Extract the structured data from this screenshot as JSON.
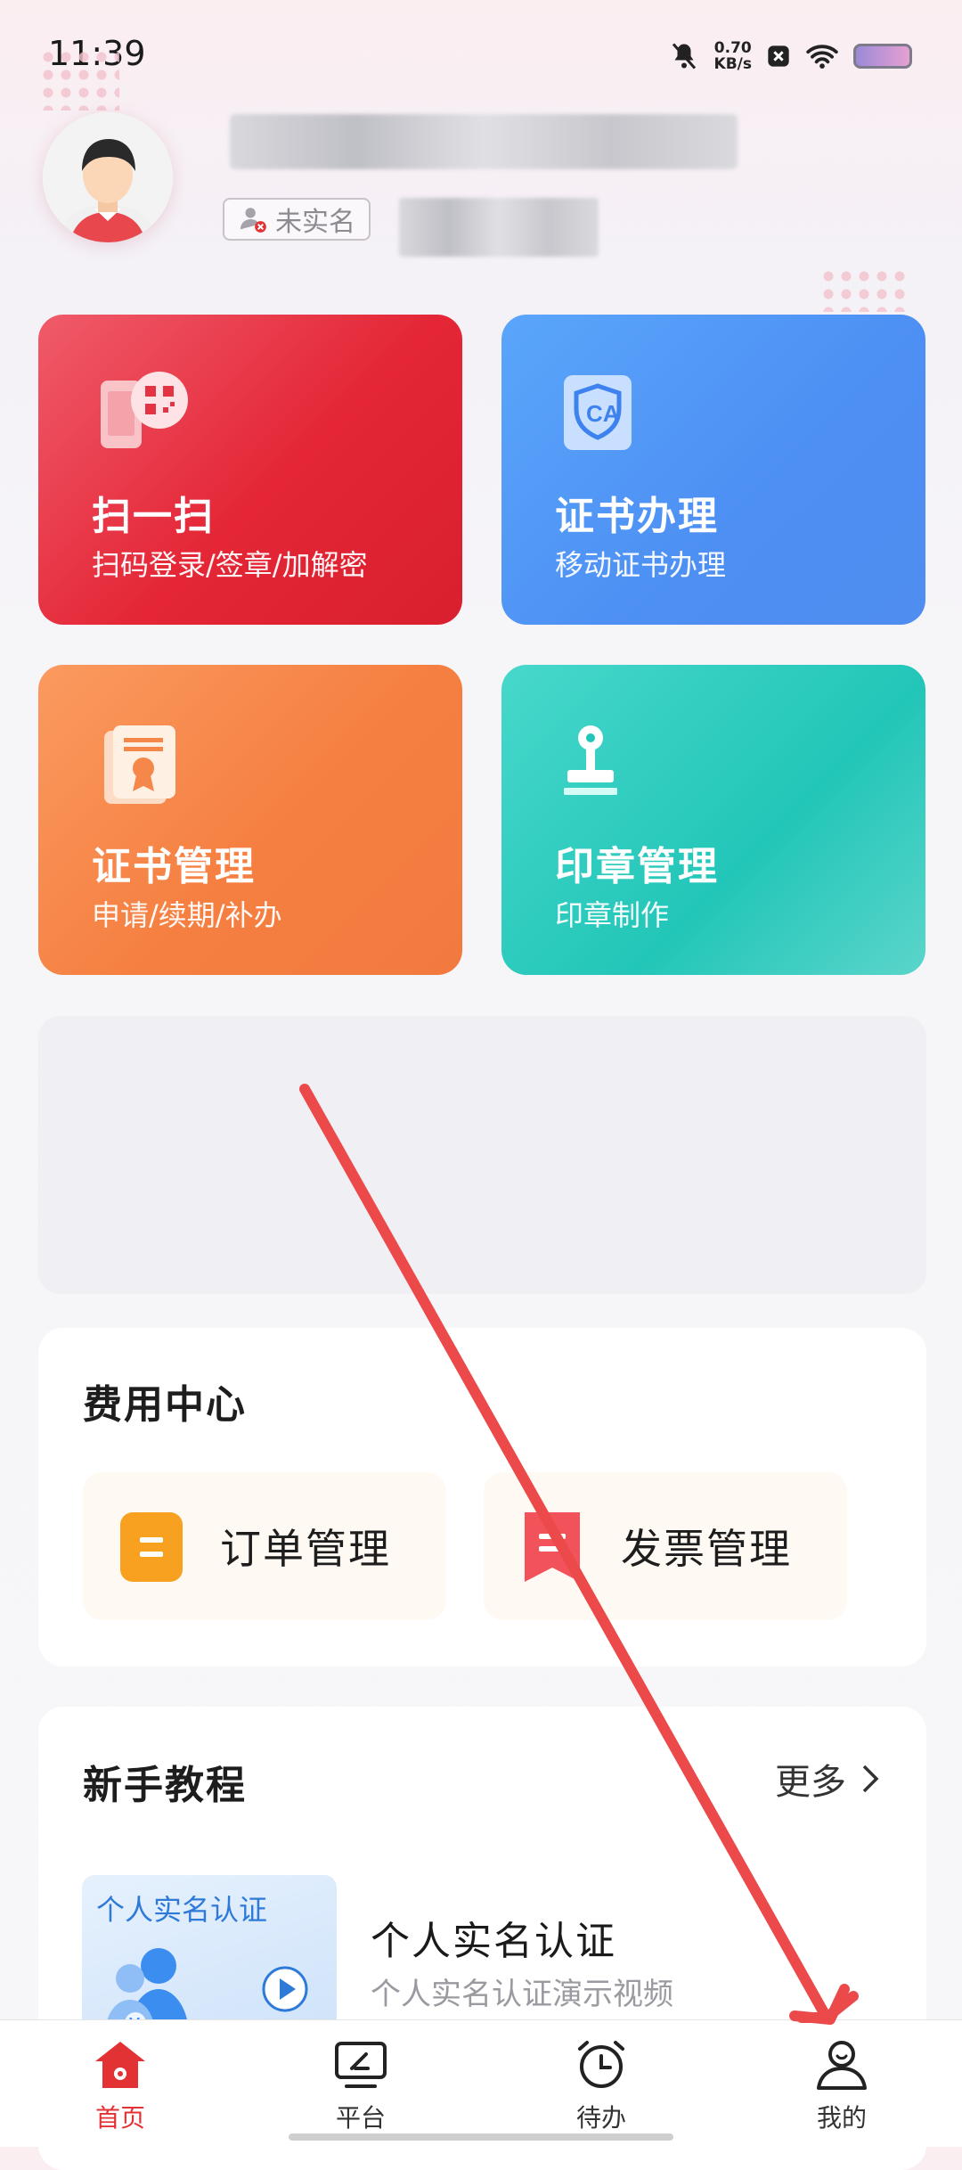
{
  "status_bar": {
    "time": "11:39",
    "net_speed_value": "0.70",
    "net_speed_unit": "KB/s"
  },
  "profile": {
    "auth_status": "未实名"
  },
  "tiles": [
    {
      "title": "扫一扫",
      "subtitle": "扫码登录/签章/加解密",
      "icon": "scan-qr-icon"
    },
    {
      "title": "证书办理",
      "subtitle": "移动证书办理",
      "icon": "ca-shield-icon"
    },
    {
      "title": "证书管理",
      "subtitle": "申请/续期/补办",
      "icon": "certificate-icon"
    },
    {
      "title": "印章管理",
      "subtitle": "印章制作",
      "icon": "stamp-icon"
    }
  ],
  "fee_center": {
    "title": "费用中心",
    "items": [
      {
        "label": "订单管理",
        "icon": "order-icon",
        "color": "#f8a020"
      },
      {
        "label": "发票管理",
        "icon": "invoice-icon",
        "color": "#f2535b"
      }
    ]
  },
  "tutorial": {
    "title": "新手教程",
    "more_label": "更多",
    "item": {
      "thumb_title": "个人实名认证",
      "title": "个人实名认证",
      "subtitle": "个人实名认证演示视频"
    }
  },
  "nav": [
    {
      "label": "首页",
      "icon": "home-icon",
      "active": true
    },
    {
      "label": "平台",
      "icon": "platform-icon",
      "active": false
    },
    {
      "label": "待办",
      "icon": "alarm-clock-icon",
      "active": false
    },
    {
      "label": "我的",
      "icon": "profile-icon",
      "active": false
    }
  ],
  "colors": {
    "accent_red": "#e33234",
    "annotation_arrow": "#ec4a4a"
  }
}
